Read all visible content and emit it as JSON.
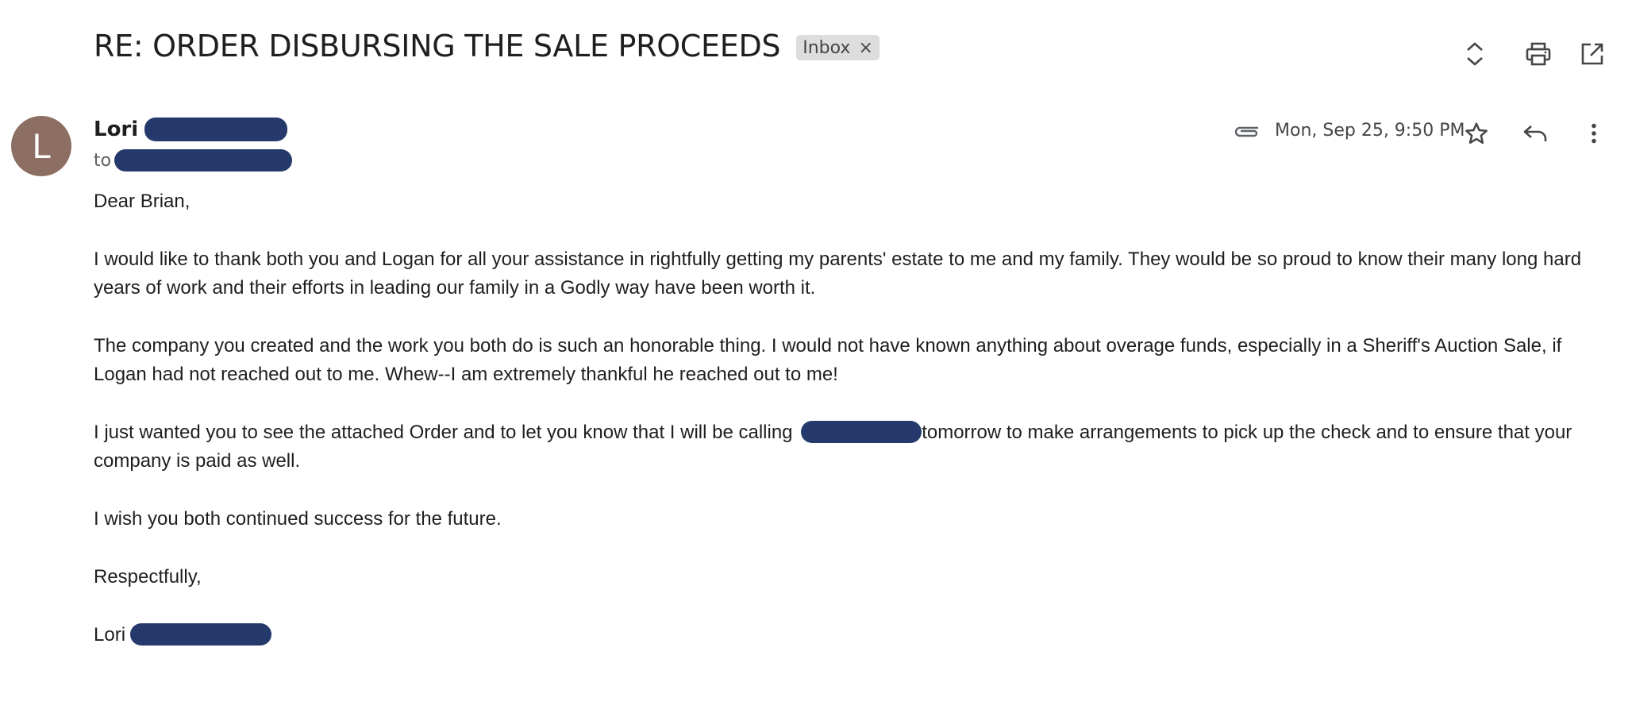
{
  "email": {
    "subject": "RE: ORDER DISBURSING THE SALE PROCEEDS",
    "label_chip": "Inbox",
    "label_remove": "×",
    "sender": {
      "initial": "L",
      "avatar_color": "#8d6e63",
      "name": "Lori",
      "to_prefix": "to"
    },
    "datetime": "Mon, Sep 25, 9:50 PM",
    "body": {
      "greeting": "Dear Brian,",
      "para1": "I would like to thank both you and Logan for all your assistance in rightfully getting my parents' estate to me and my family.  They would be so proud to know their many long hard years of work and their efforts in leading our family in a Godly way have been worth it.",
      "para2": "The company you created and the work you both do is such an honorable thing. I would not have known anything about overage funds, especially in a Sheriff's Auction Sale, if Logan had not reached out to me. Whew--I am extremely thankful he reached out to me!",
      "para3_before": "I just wanted you to see the attached Order and to let you know that I will be calling ",
      "para3_after": "tomorrow to make arrangements to pick up the check and to ensure that your company is paid as well.",
      "para4": "I wish you both continued success for the future.",
      "closing": "Respectfully,",
      "signature": "Lori"
    }
  },
  "icons": {
    "expand": "unfold-icon",
    "print": "print-icon",
    "open_new_window": "open-in-new-icon",
    "attachment": "paperclip-icon",
    "star": "star-icon",
    "reply": "reply-icon",
    "more": "more-vert-icon"
  },
  "colors": {
    "redaction": "#25396c",
    "chip_bg": "#dddddd",
    "icon": "#444746"
  }
}
